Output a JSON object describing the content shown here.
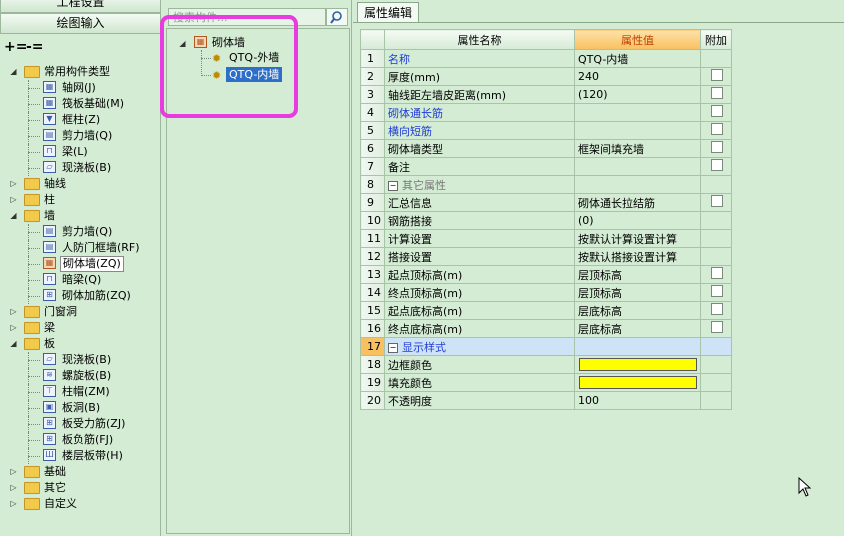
{
  "left_panel": {
    "nav_top": "工程设置",
    "nav_draw": "绘图输入",
    "tree": [
      {
        "label": "常用构件类型",
        "level": 0,
        "expanded": true,
        "type": "folder"
      },
      {
        "label": "轴网(J)",
        "level": 1,
        "icon": "grid"
      },
      {
        "label": "筏板基础(M)",
        "level": 1,
        "icon": "grid"
      },
      {
        "label": "框柱(Z)",
        "level": 1,
        "icon": "col"
      },
      {
        "label": "剪力墙(Q)",
        "level": 1,
        "icon": "wall"
      },
      {
        "label": "梁(L)",
        "level": 1,
        "icon": "beam"
      },
      {
        "label": "现浇板(B)",
        "level": 1,
        "icon": "slab"
      },
      {
        "label": "轴线",
        "level": 0,
        "expanded": false,
        "type": "folder"
      },
      {
        "label": "柱",
        "level": 0,
        "expanded": false,
        "type": "folder"
      },
      {
        "label": "墙",
        "level": 0,
        "expanded": true,
        "type": "folder"
      },
      {
        "label": "剪力墙(Q)",
        "level": 1,
        "icon": "wall"
      },
      {
        "label": "人防门框墙(RF)",
        "level": 1,
        "icon": "wall"
      },
      {
        "label": "砌体墙(ZQ)",
        "level": 1,
        "icon": "brick",
        "selected": true
      },
      {
        "label": "暗梁(Q)",
        "level": 1,
        "icon": "beam"
      },
      {
        "label": "砌体加筋(ZQ)",
        "level": 1,
        "icon": "rebar"
      },
      {
        "label": "门窗洞",
        "level": 0,
        "expanded": false,
        "type": "folder"
      },
      {
        "label": "梁",
        "level": 0,
        "expanded": false,
        "type": "folder"
      },
      {
        "label": "板",
        "level": 0,
        "expanded": true,
        "type": "folder"
      },
      {
        "label": "现浇板(B)",
        "level": 1,
        "icon": "slab"
      },
      {
        "label": "螺旋板(B)",
        "level": 1,
        "icon": "spiral"
      },
      {
        "label": "柱帽(ZM)",
        "level": 1,
        "icon": "cap"
      },
      {
        "label": "板洞(B)",
        "level": 1,
        "icon": "hole"
      },
      {
        "label": "板受力筋(ZJ)",
        "level": 1,
        "icon": "rebar"
      },
      {
        "label": "板负筋(FJ)",
        "level": 1,
        "icon": "rebar"
      },
      {
        "label": "楼层板带(H)",
        "level": 1,
        "icon": "band"
      },
      {
        "label": "基础",
        "level": 0,
        "expanded": false,
        "type": "folder"
      },
      {
        "label": "其它",
        "level": 0,
        "expanded": false,
        "type": "folder"
      },
      {
        "label": "自定义",
        "level": 0,
        "expanded": false,
        "type": "folder"
      }
    ]
  },
  "middle_panel": {
    "search_placeholder": "搜索构件...",
    "tree_root": "砌体墙",
    "tree_items": [
      "QTQ-外墙",
      "QTQ-内墙"
    ]
  },
  "right_panel": {
    "tab_label": "属性编辑",
    "headers": {
      "name": "属性名称",
      "value": "属性值",
      "extra": "附加"
    },
    "rows": [
      {
        "num": "1",
        "name": "名称",
        "value": "QTQ-内墙",
        "style": "blue",
        "check": false
      },
      {
        "num": "2",
        "name": "厚度(mm)",
        "value": "240",
        "style": "",
        "check": true
      },
      {
        "num": "3",
        "name": "轴线距左墙皮距离(mm)",
        "value": "(120)",
        "style": "",
        "check": true
      },
      {
        "num": "4",
        "name": "砌体通长筋",
        "value": "",
        "style": "blue",
        "check": true
      },
      {
        "num": "5",
        "name": "横向短筋",
        "value": "",
        "style": "blue",
        "check": true
      },
      {
        "num": "6",
        "name": "砌体墙类型",
        "value": "框架间填充墙",
        "style": "",
        "check": true
      },
      {
        "num": "7",
        "name": "备注",
        "value": "",
        "style": "",
        "check": true
      },
      {
        "num": "8",
        "name": "其它属性",
        "value": "",
        "style": "group",
        "check": false
      },
      {
        "num": "9",
        "name": "汇总信息",
        "value": "砌体通长拉结筋",
        "style": "sub",
        "check": true
      },
      {
        "num": "10",
        "name": "钢筋搭接",
        "value": "(0)",
        "style": "sub",
        "check": false
      },
      {
        "num": "11",
        "name": "计算设置",
        "value": "按默认计算设置计算",
        "style": "sub",
        "check": false
      },
      {
        "num": "12",
        "name": "搭接设置",
        "value": "按默认搭接设置计算",
        "style": "sub",
        "check": false
      },
      {
        "num": "13",
        "name": "起点顶标高(m)",
        "value": "层顶标高",
        "style": "sub",
        "check": true
      },
      {
        "num": "14",
        "name": "终点顶标高(m)",
        "value": "层顶标高",
        "style": "sub",
        "check": true
      },
      {
        "num": "15",
        "name": "起点底标高(m)",
        "value": "层底标高",
        "style": "sub",
        "check": true
      },
      {
        "num": "16",
        "name": "终点底标高(m)",
        "value": "层底标高",
        "style": "sub",
        "check": true
      },
      {
        "num": "17",
        "name": "显示样式",
        "value": "",
        "style": "group-active",
        "check": false
      },
      {
        "num": "18",
        "name": "边框颜色",
        "value": "",
        "style": "sub",
        "swatch": "#ffff00",
        "check": false
      },
      {
        "num": "19",
        "name": "填充颜色",
        "value": "",
        "style": "sub",
        "swatch": "#ffff00",
        "check": false
      },
      {
        "num": "20",
        "name": "不透明度",
        "value": "100",
        "style": "sub",
        "check": false
      }
    ]
  }
}
